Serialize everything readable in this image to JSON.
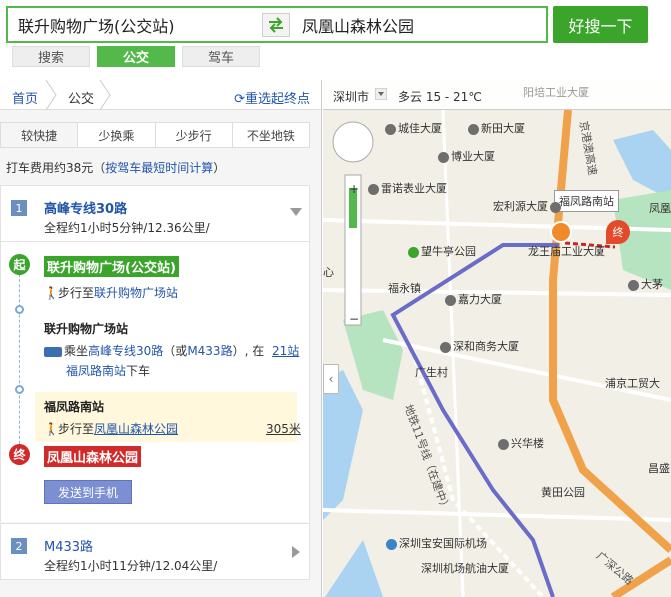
{
  "search": {
    "from": "联升购物广场(公交站)",
    "to": "凤凰山森林公园",
    "button": "好搜一下",
    "modes": [
      "搜索",
      "公交",
      "驾车"
    ],
    "active_mode": "公交"
  },
  "breadcrumb": {
    "home": "首页",
    "current": "公交",
    "reselect": "重选起终点"
  },
  "strategy_tabs": [
    "较快捷",
    "少换乘",
    "少步行",
    "不坐地铁"
  ],
  "taxi": {
    "prefix": "打车费用约38元（",
    "link": "按驾车最短时间计算",
    "suffix": "）"
  },
  "routes": [
    {
      "num": "1",
      "name": "高峰专线30路",
      "summary": "全程约1小时5分钟/12.36公里/"
    },
    {
      "num": "2",
      "name": "M433路",
      "summary": "全程约1小时11分钟/12.04公里/"
    }
  ],
  "detail": {
    "start_pin": "起",
    "start_name": "联升购物广场(公交站)",
    "walk1_prefix": "步行至",
    "walk1_target": "联升购物广场站",
    "board_station": "联升购物广场站",
    "ride_prefix": "乘坐",
    "ride_line": "高峰专线30路",
    "ride_alt_open": "（或",
    "ride_alt_line": "M433路",
    "ride_alt_close": "）, 在",
    "ride_stops": "21站",
    "alight_station_link": "福凤路南站",
    "alight_suffix": "下车",
    "alight_station": "福凤路南站",
    "walk2_prefix": "步行至",
    "walk2_target": "凤凰山森林公园",
    "walk2_distance": "305米",
    "end_pin": "终",
    "end_name": "凤凰山森林公园",
    "send_button": "发送到手机"
  },
  "map": {
    "city": "深圳市",
    "weather": "多云 15 - 21℃",
    "callout": "福凤路南站",
    "end_marker": "终",
    "labels": [
      "城佳大厦",
      "新田大厦",
      "博业大厦",
      "雷诺表业大厦",
      "宏利源大厦",
      "望牛亭公园",
      "龙王庙工业大厦",
      "嘉力大厦",
      "福永镇",
      "深和商务大厦",
      "广生村",
      "浦京工贸大",
      "兴华楼",
      "黄田公园",
      "深圳宝安国际机场",
      "深圳机场航油大厦",
      "昌盛",
      "大茅",
      "凤凰",
      "心",
      "阳培工业大厦"
    ],
    "roads": [
      "京港澳高速",
      "地铁11号线（在建中）",
      "广深公路"
    ]
  },
  "colors": {
    "brand_green": "#54b94b",
    "button_green": "#3aa52a",
    "link_blue": "#2255aa",
    "route_purple": "#6a6cc8",
    "expressway_orange": "#f0a24a"
  }
}
